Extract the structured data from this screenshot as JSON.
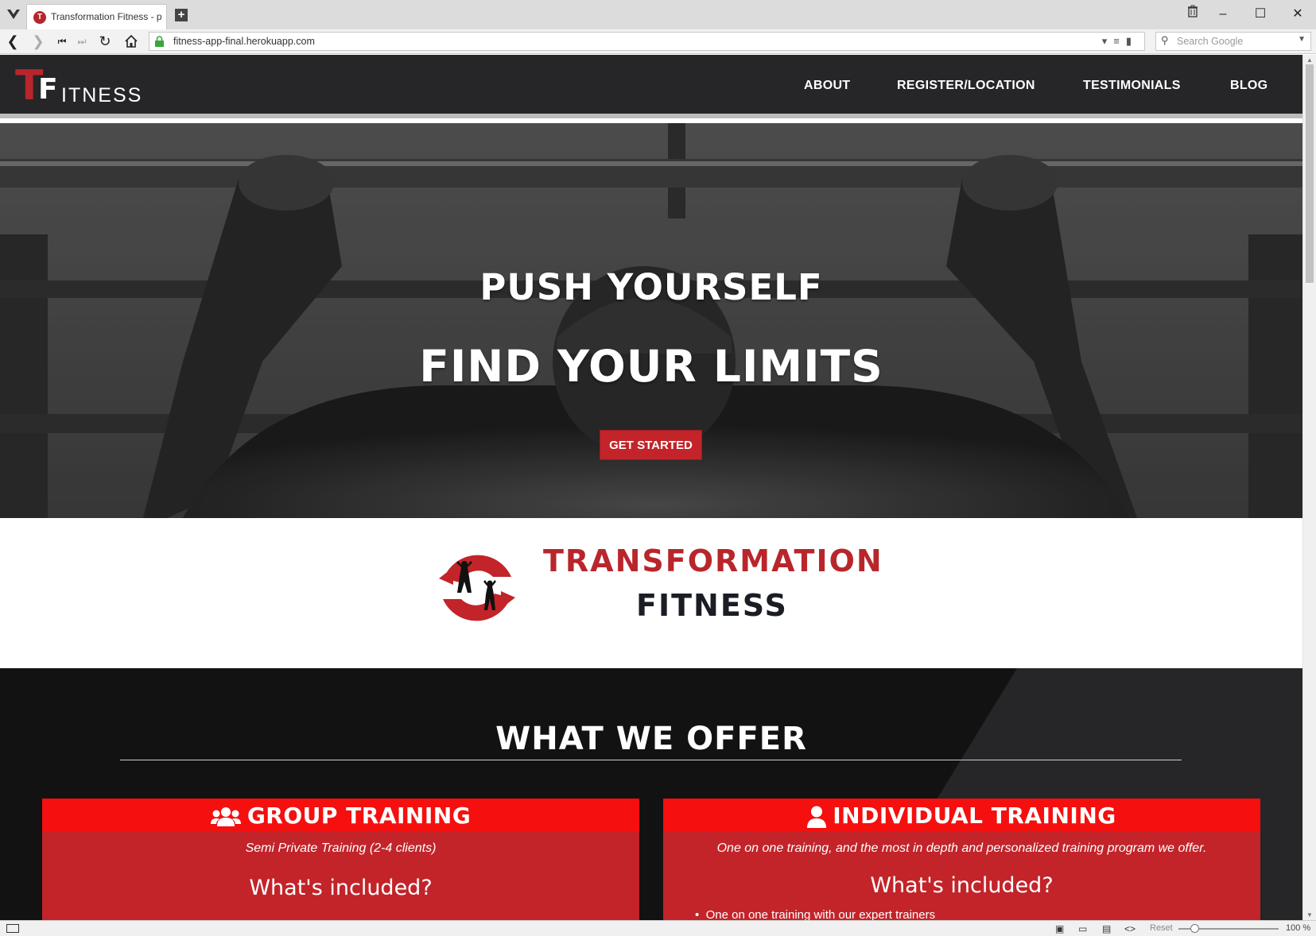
{
  "browser": {
    "tab_title": "Transformation Fitness - per",
    "url": "fitness-app-final.herokuapp.com",
    "search_placeholder": "Search Google",
    "zoom_reset": "Reset",
    "zoom_level": "100 %"
  },
  "site": {
    "logo": {
      "t": "T",
      "f": "F",
      "rest": "ITNESS"
    },
    "nav": [
      "ABOUT",
      "REGISTER/LOCATION",
      "TESTIMONIALS",
      "BLOG"
    ]
  },
  "hero": {
    "line1": "PUSH YOURSELF",
    "line2": "FIND YOUR LIMITS",
    "cta": "GET STARTED"
  },
  "brand": {
    "line1": "TRANSFORMATION",
    "line2": "FITNESS"
  },
  "offer": {
    "heading": "WHAT WE OFFER",
    "cards": [
      {
        "title": "GROUP TRAINING",
        "icon": "users-icon",
        "subtitle": "Semi Private Training (2-4 clients)",
        "included": "What's included?"
      },
      {
        "title": "INDIVIDUAL TRAINING",
        "icon": "user-icon",
        "subtitle": "One on one training, and the most in depth and personalized training program we offer.",
        "included": "What's included?",
        "first_item": "One on one training with our expert trainers"
      }
    ]
  },
  "colors": {
    "accent_red": "#c2242a",
    "card_header_red": "#f50f0f",
    "nav_bg": "#262527",
    "offer_bg": "#121212"
  }
}
